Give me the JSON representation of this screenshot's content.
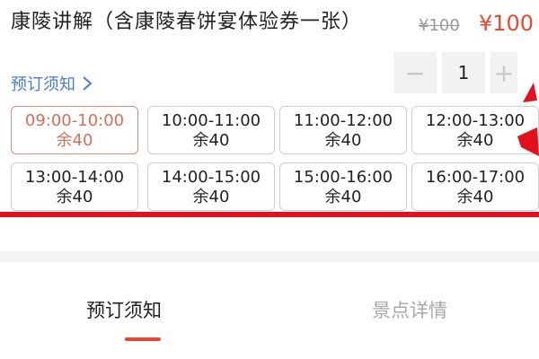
{
  "product": {
    "title": "康陵讲解（含康陵春饼宴体验券一张）",
    "original_price": "¥100",
    "current_price": "¥100"
  },
  "notice_link": {
    "label": "预订须知",
    "icon": "chevron-right-icon"
  },
  "stepper": {
    "minus_label": "−",
    "value": "1",
    "plus_label": "+"
  },
  "time_slots": [
    {
      "time": "09:00-10:00",
      "remain": "余40",
      "selected": true
    },
    {
      "time": "10:00-11:00",
      "remain": "余40",
      "selected": false
    },
    {
      "time": "11:00-12:00",
      "remain": "余40",
      "selected": false
    },
    {
      "time": "12:00-13:00",
      "remain": "余40",
      "selected": false
    },
    {
      "time": "13:00-14:00",
      "remain": "余40",
      "selected": false
    },
    {
      "time": "14:00-15:00",
      "remain": "余40",
      "selected": false
    },
    {
      "time": "15:00-16:00",
      "remain": "余40",
      "selected": false
    },
    {
      "time": "16:00-17:00",
      "remain": "余40",
      "selected": false
    }
  ],
  "tabs": [
    {
      "label": "预订须知",
      "active": true
    },
    {
      "label": "景点详情",
      "active": false
    }
  ],
  "colors": {
    "accent": "#e8482f",
    "annotation_red": "#e3101e",
    "link_blue": "#4a7bd6",
    "selected_border": "#e08a7a"
  }
}
